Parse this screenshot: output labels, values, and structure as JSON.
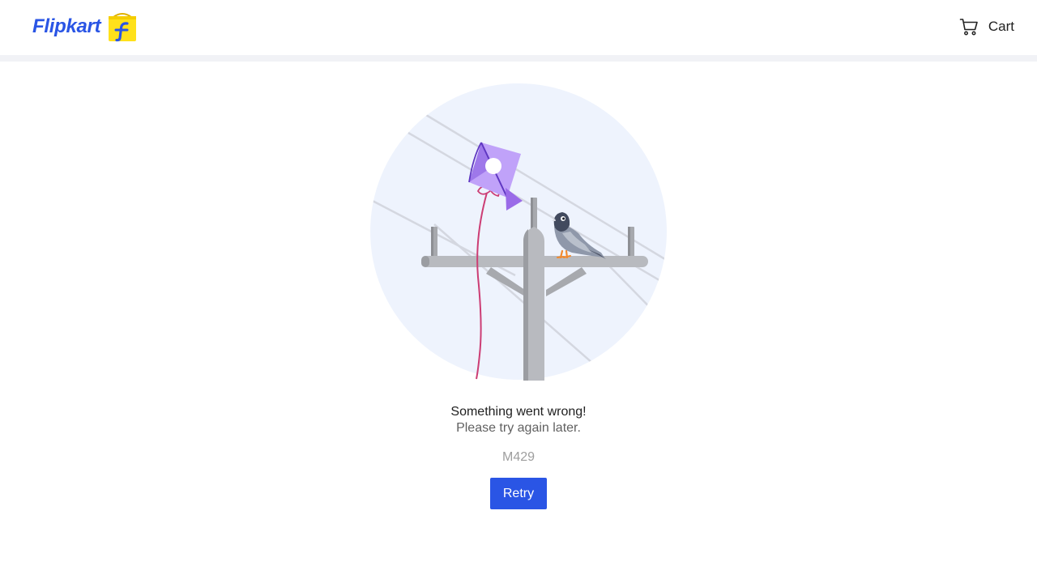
{
  "colors": {
    "brand": "#2a55e5",
    "brand_yellow": "#ffe11b",
    "page_bg": "#ffffff",
    "divider": "#f1f2f6",
    "illustration_bg": "#eef3fd"
  },
  "header": {
    "logo_text": "Flipkart",
    "logo_icon": "flipkart-bag-icon",
    "cart_icon": "cart-icon",
    "cart_label": "Cart"
  },
  "error": {
    "illustration": "kite-on-power-pole-with-pigeon",
    "title": "Something went wrong!",
    "subtitle": "Please try again later.",
    "code": "M429",
    "retry_label": "Retry"
  }
}
